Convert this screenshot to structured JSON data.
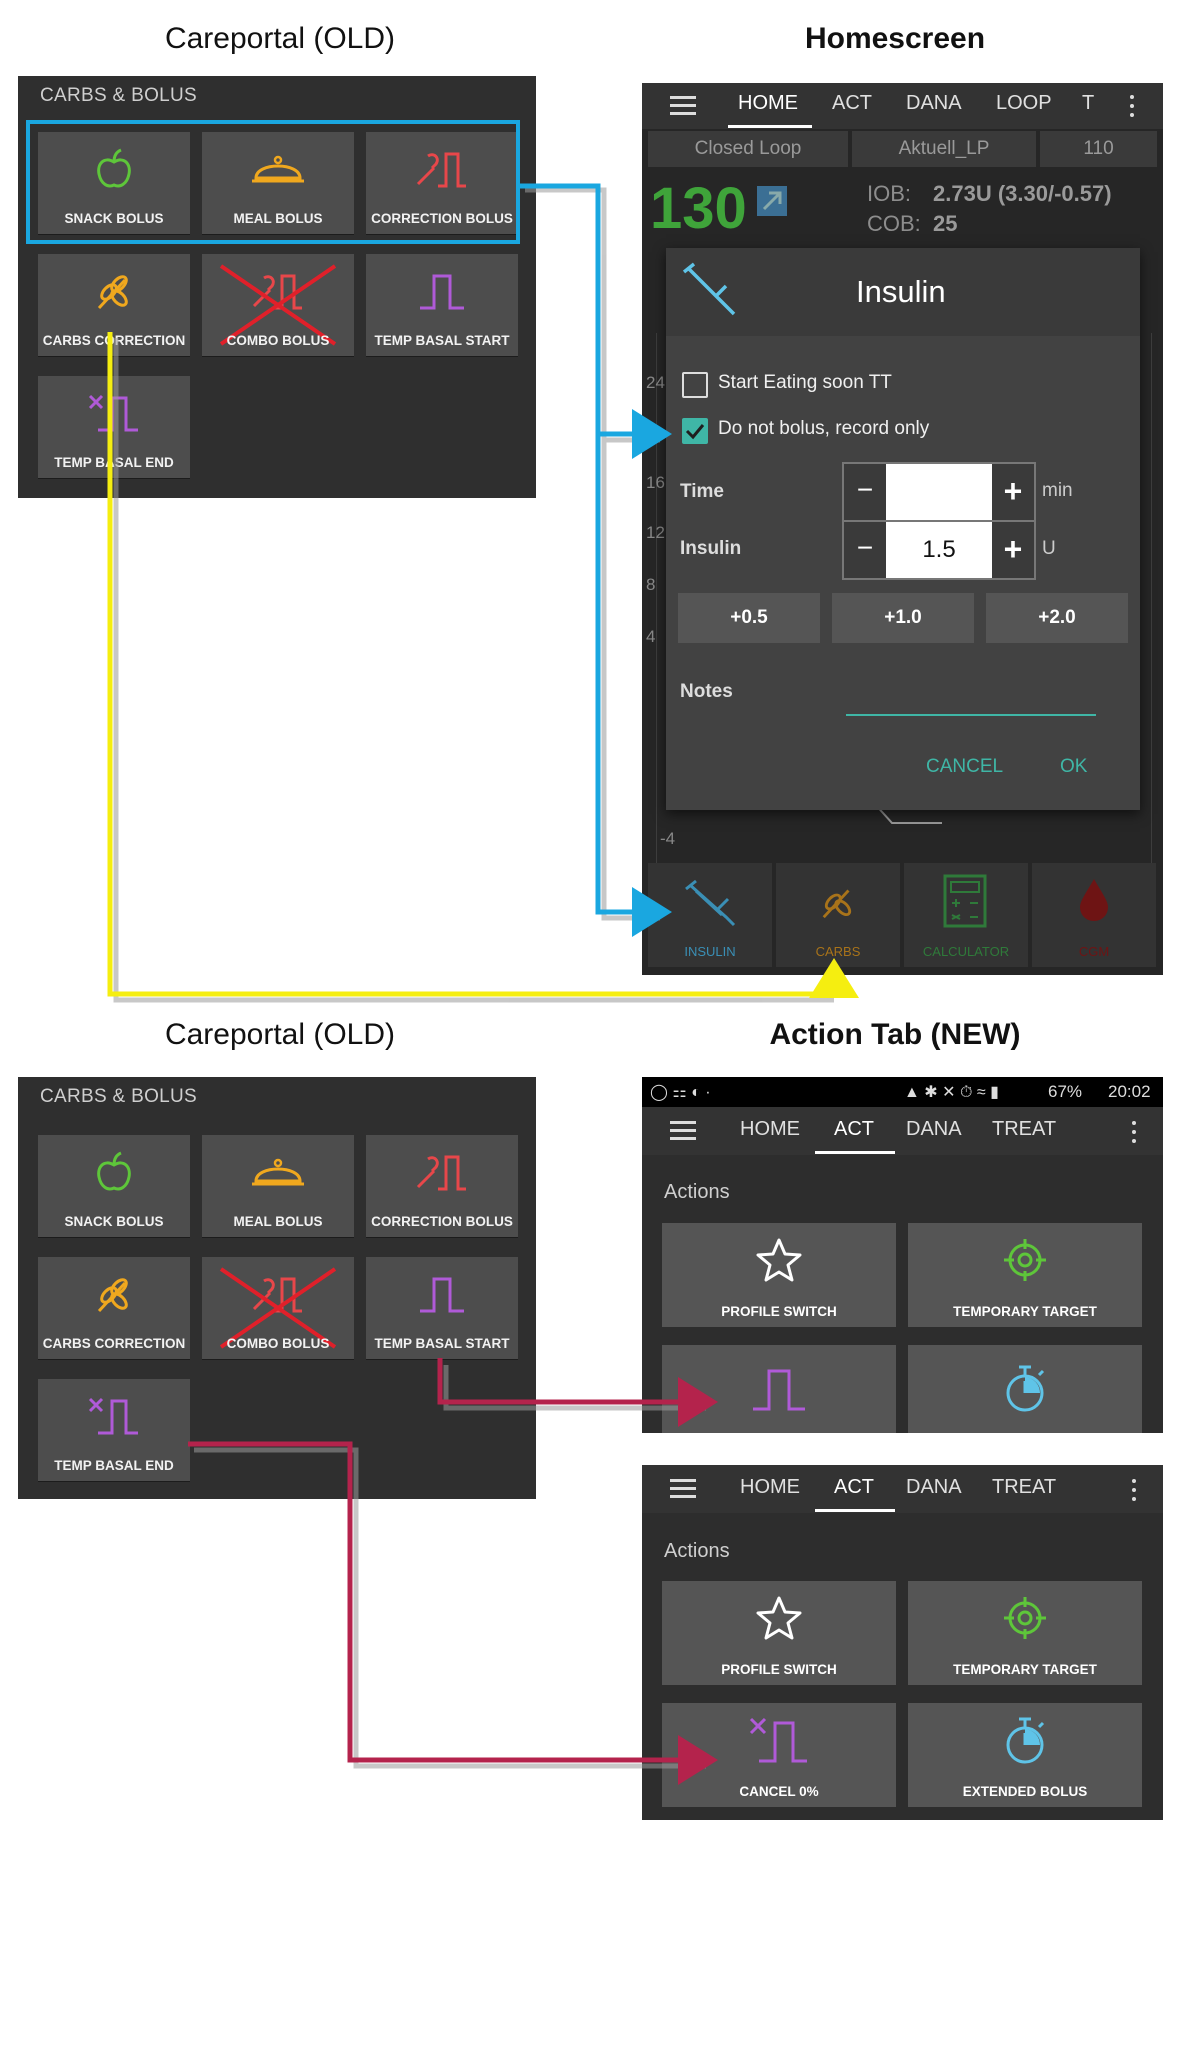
{
  "headings": {
    "careportal_top": "Careportal (OLD)",
    "homescreen": "Homescreen",
    "careportal_bottom": "Careportal (OLD)",
    "action_tab": "Action Tab (NEW)"
  },
  "careportal": {
    "title": "CARBS & BOLUS",
    "tiles": [
      "SNACK BOLUS",
      "MEAL BOLUS",
      "CORRECTION BOLUS",
      "CARBS CORRECTION",
      "COMBO BOLUS",
      "TEMP BASAL START",
      "TEMP BASAL END"
    ]
  },
  "home": {
    "tabs": [
      "HOME",
      "ACT",
      "DANA",
      "LOOP",
      "T"
    ],
    "chips": [
      "Closed Loop",
      "Aktuell_LP",
      "110"
    ],
    "bg": "130",
    "iob_label": "IOB:",
    "iob_value": "2.73U (3.30/-0.57)",
    "cob_label": "COB:",
    "cob_value": "25",
    "axis_ticks": [
      "24",
      "16",
      "12",
      "8",
      "4",
      "-4"
    ],
    "bottom_buttons": [
      "INSULIN",
      "CARBS",
      "CALCULATOR",
      "CGM"
    ]
  },
  "dialog": {
    "title": "Insulin",
    "check1": "Start Eating soon TT",
    "check1_checked": false,
    "check2": "Do not bolus, record only",
    "check2_checked": true,
    "time_label": "Time",
    "time_value": "",
    "time_unit": "min",
    "insulin_label": "Insulin",
    "insulin_value": "1.5",
    "insulin_unit": "U",
    "minus": "−",
    "plus": "+",
    "quick": [
      "+0.5",
      "+1.0",
      "+2.0"
    ],
    "notes_label": "Notes",
    "cancel": "CANCEL",
    "ok": "OK"
  },
  "status_bar": {
    "battery": "67%",
    "time": "20:02"
  },
  "act": {
    "tabs": [
      "HOME",
      "ACT",
      "DANA",
      "TREAT"
    ],
    "section": "Actions",
    "tiles": [
      "PROFILE SWITCH",
      "TEMPORARY TARGET",
      "CANCEL 0%",
      "EXTENDED BOLUS"
    ]
  },
  "colors": {
    "blue_arrow": "#1aa7e0",
    "yellow_arrow": "#f5ee10",
    "red_arrow": "#b4234c",
    "green": "#5ec63a",
    "orange": "#f0a81e",
    "red_icon": "#e8474a",
    "purple": "#b05ad8",
    "teal": "#3fb6a6",
    "cyan_icon": "#5fc4e8"
  }
}
